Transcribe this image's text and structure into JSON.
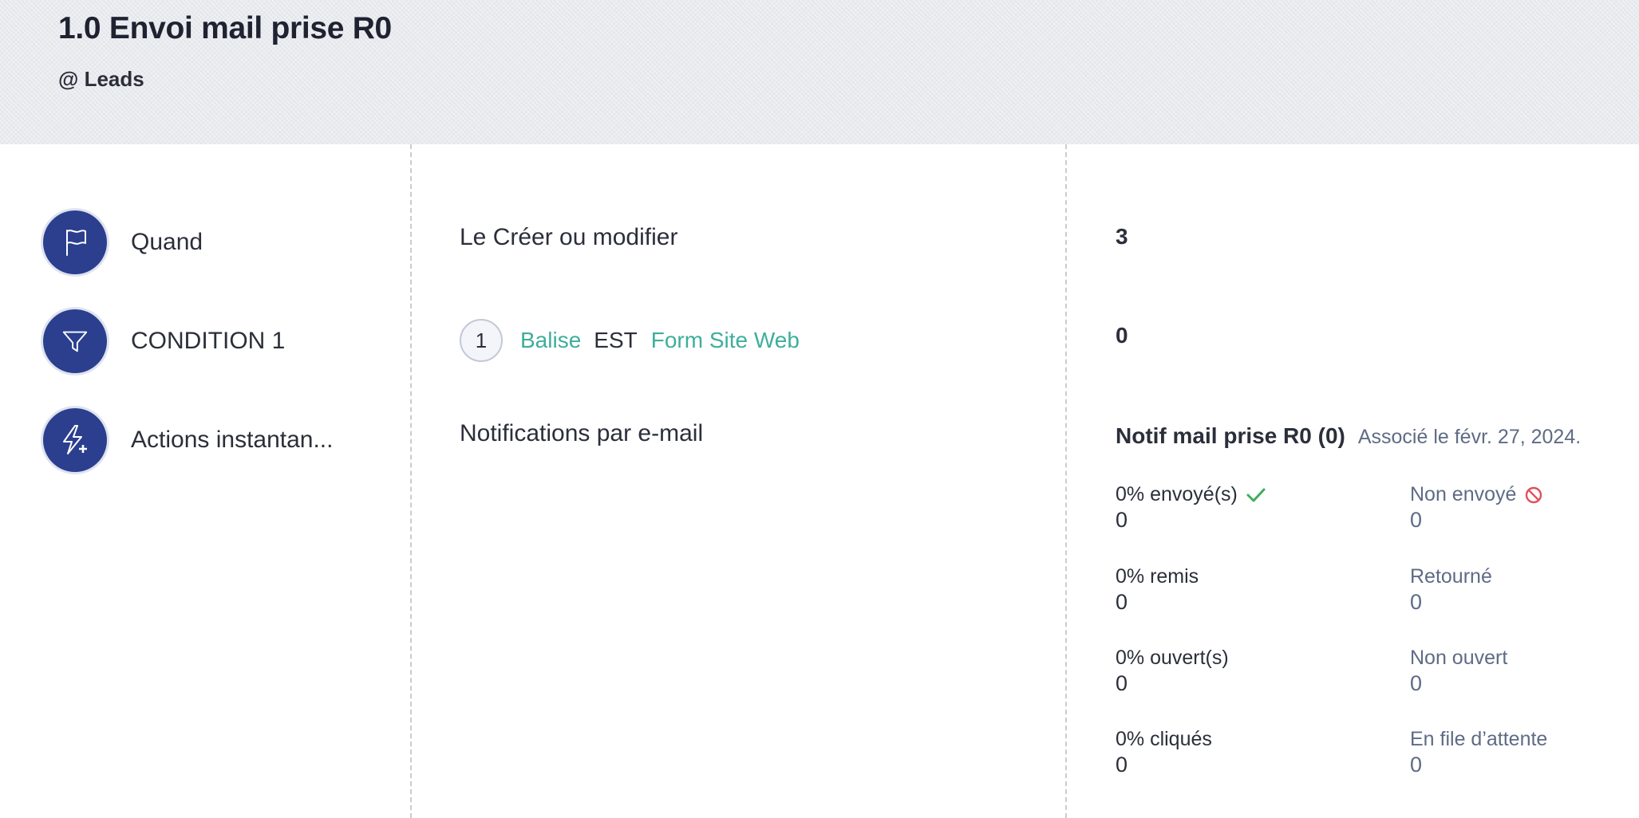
{
  "header": {
    "title": "1.0 Envoi mail prise R0",
    "module": "@ Leads"
  },
  "steps": [
    {
      "label": "Quand",
      "icon": "flag-icon"
    },
    {
      "label": "CONDITION 1",
      "icon": "filter-icon"
    },
    {
      "label": "Actions instantan...",
      "icon": "instant-action-icon"
    }
  ],
  "trigger": {
    "text": "Le Créer ou modifier"
  },
  "condition": {
    "number": "1",
    "field": "Balise",
    "operator": "EST",
    "value": "Form Site Web"
  },
  "actions": {
    "text": "Notifications par e-mail"
  },
  "counts": {
    "trigger": "3",
    "condition": "0"
  },
  "notification": {
    "name": "Notif mail prise R0 (0)",
    "associated": "Associé le févr. 27, 2024.",
    "stats": {
      "sent": {
        "label": "0% envoyé(s)",
        "value": "0"
      },
      "not_sent": {
        "label": "Non envoyé",
        "value": "0"
      },
      "delivered": {
        "label": "0% remis",
        "value": "0"
      },
      "bounced": {
        "label": "Retourné",
        "value": "0"
      },
      "opened": {
        "label": "0% ouvert(s)",
        "value": "0"
      },
      "unopened": {
        "label": "Non ouvert",
        "value": "0"
      },
      "clicked": {
        "label": "0% cliqués",
        "value": "0"
      },
      "queued": {
        "label": "En file d’attente",
        "value": "0"
      }
    }
  },
  "colors": {
    "icon_bg": "#2b3f8e",
    "link_green": "#3fae9c",
    "check_green": "#3fae5a",
    "blocked_red": "#e0505a",
    "muted": "#5f6b85"
  }
}
